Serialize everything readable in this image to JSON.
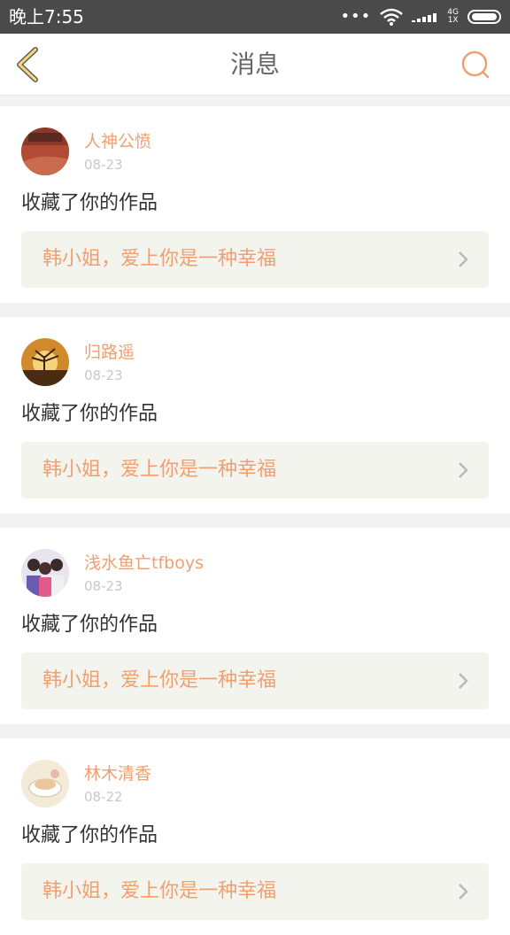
{
  "status_bar": {
    "time": "晚上7:55",
    "dots": "•••",
    "network_top": "4G",
    "network_bottom": "1X"
  },
  "header": {
    "title": "消息",
    "back_icon": "chevron-left-icon",
    "search_icon": "search-icon",
    "accent_color": "#f0a070"
  },
  "messages": [
    {
      "username": "人神公愤",
      "date": "08-23",
      "action": "收藏了你的作品",
      "work_title": "韩小姐，爱上你是一种幸福",
      "avatar": "avatar-red-landscape"
    },
    {
      "username": "归路遥",
      "date": "08-23",
      "action": "收藏了你的作品",
      "work_title": "韩小姐，爱上你是一种幸福",
      "avatar": "avatar-sunset-tree"
    },
    {
      "username": "浅水鱼亡tfboys",
      "date": "08-23",
      "action": "收藏了你的作品",
      "work_title": "韩小姐，爱上你是一种幸福",
      "avatar": "avatar-people"
    },
    {
      "username": "林木清香",
      "date": "08-22",
      "action": "收藏了你的作品",
      "work_title": "韩小姐，爱上你是一种幸福",
      "avatar": "avatar-teacup"
    }
  ]
}
